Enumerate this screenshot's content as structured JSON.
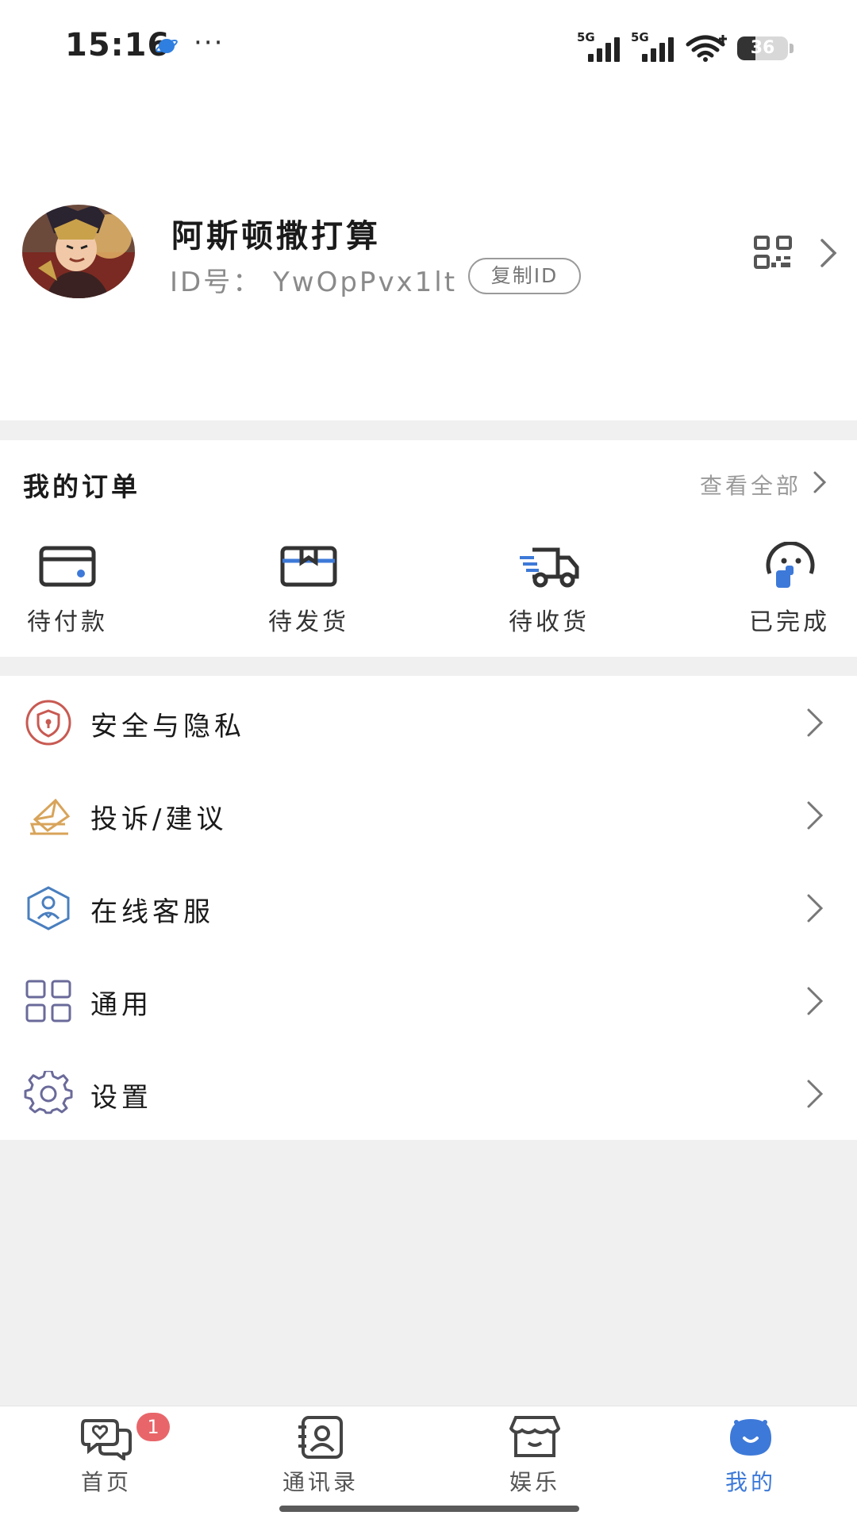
{
  "status_bar": {
    "time": "15:16",
    "more": "···",
    "network_1": "5G",
    "network_2": "5G",
    "battery": "36",
    "battery_level": 0.36
  },
  "profile": {
    "name": "阿斯顿撒打算",
    "id_text": "ID号： YwOpPvx1lt",
    "copy_id_label": "复制ID",
    "avatar": "avatar-anime-hero",
    "qr_icon": "qr-code-icon"
  },
  "orders": {
    "title": "我的订单",
    "view_all": "查看全部",
    "items": [
      {
        "label": "待付款",
        "icon": "wallet-icon"
      },
      {
        "label": "待发货",
        "icon": "package-box-icon"
      },
      {
        "label": "待收货",
        "icon": "delivery-truck-icon"
      },
      {
        "label": "已完成",
        "icon": "thumbs-up-face-icon"
      }
    ]
  },
  "menu": {
    "items": [
      {
        "label": "安全与隐私",
        "icon": "shield-icon"
      },
      {
        "label": "投诉/建议",
        "icon": "envelope-icon"
      },
      {
        "label": "在线客服",
        "icon": "customer-service-icon"
      },
      {
        "label": "通用",
        "icon": "grid-icon"
      },
      {
        "label": "设置",
        "icon": "gear-icon"
      }
    ]
  },
  "tabbar": {
    "items": [
      {
        "label": "首页",
        "icon": "chat-bubbles-icon",
        "badge": "1"
      },
      {
        "label": "通讯录",
        "icon": "contacts-icon"
      },
      {
        "label": "娱乐",
        "icon": "shop-icon"
      },
      {
        "label": "我的",
        "icon": "profile-face-icon",
        "active": true
      }
    ]
  },
  "colors": {
    "accent": "#3d79d8",
    "badge": "#e8666a",
    "background": "#f0f0f0"
  }
}
